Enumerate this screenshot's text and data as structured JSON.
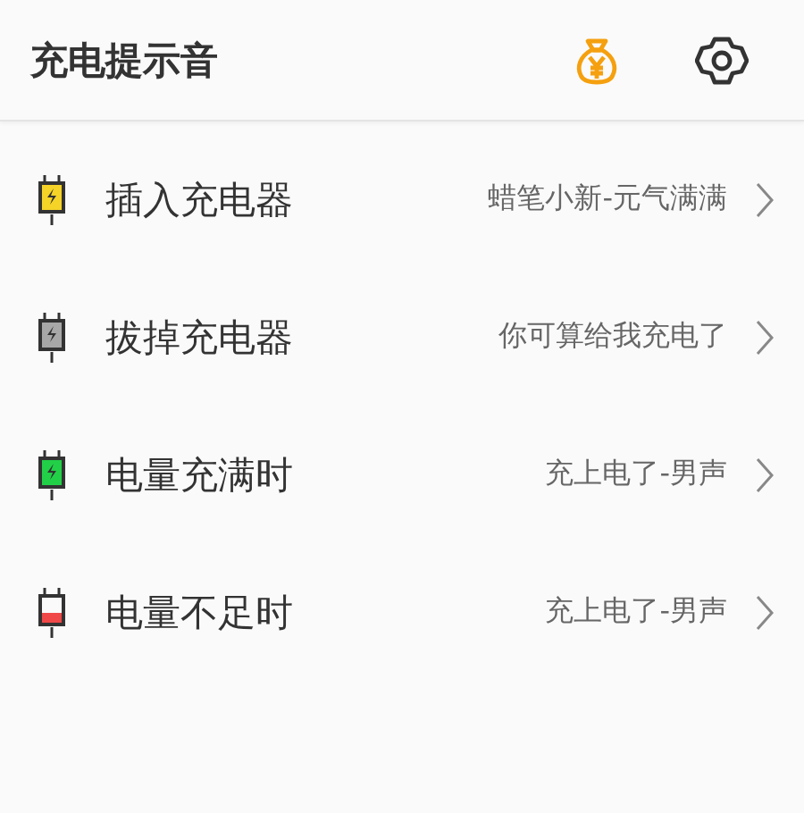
{
  "app_bar": {
    "title": "充电提示音"
  },
  "items": [
    {
      "kind": "bolt",
      "color": "#f5d327",
      "label": "插入充电器",
      "value": "蜡笔小新-元气满满"
    },
    {
      "kind": "bolt",
      "color": "#a8a8a8",
      "label": "拔掉充电器",
      "value": "你可算给我充电了"
    },
    {
      "kind": "bolt",
      "color": "#22d048",
      "label": "电量充满时",
      "value": "充上电了-男声"
    },
    {
      "kind": "low",
      "color": "#f04848",
      "label": "电量不足时",
      "value": "充上电了-男声"
    }
  ]
}
